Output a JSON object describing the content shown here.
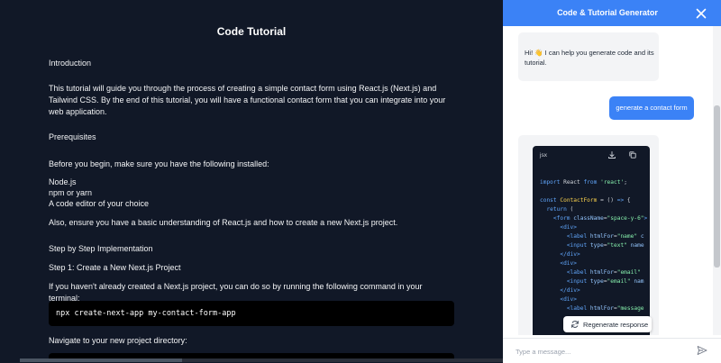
{
  "tutorial": {
    "title": "Code Tutorial",
    "intro_heading": "Introduction",
    "intro_text": "This tutorial will guide you through the process of creating a simple contact form using React.js (Next.js) and Tailwind CSS. By the end of this tutorial, you will have a functional contact form that you can integrate into your web application.",
    "prereq_heading": "Prerequisites",
    "prereq_text": "Before you begin, make sure you have the following installed:",
    "prereq_items": [
      "Node.js",
      "npm or yarn",
      "A code editor of your choice"
    ],
    "prereq_note": "Also, ensure you have a basic understanding of React.js and how to create a new Next.js project.",
    "steps_heading": "Step by Step Implementation",
    "step1_heading": "Step 1: Create a New Next.js Project",
    "step1_text": "If you haven't already created a Next.js project, you can do so by running the following command in your terminal:",
    "step1_command": "npx create-next-app my-contact-form-app",
    "step2_text": "Navigate to your new project directory:"
  },
  "panel": {
    "title": "Code & Tutorial Generator",
    "bot_greeting": "Hi! 👋 I can help you generate code and its tutorial.",
    "user_message": "generate a contact form",
    "code_lang": "jsx",
    "code_lines": [
      "import React from 'react';",
      "",
      "const ContactForm = () => {",
      "  return (",
      "    <form className=\"space-y-6\">",
      "      <div>",
      "        <label htmlFor=\"name\" c",
      "        <input type=\"text\" name",
      "      </div>",
      "      <div>",
      "        <label htmlFor=\"email\"",
      "        <input type=\"email\" nam",
      "      </div>",
      "      <div>",
      "        <label htmlFor=\"message"
    ],
    "regenerate_label": "Regenerate response",
    "input_placeholder": "Type a message..."
  },
  "colors": {
    "header": "#3b82f6",
    "main_bg": "#111827",
    "user_bubble": "#3b82f6"
  },
  "icons": [
    "close-icon",
    "download-icon",
    "copy-icon",
    "refresh-icon",
    "send-icon"
  ]
}
